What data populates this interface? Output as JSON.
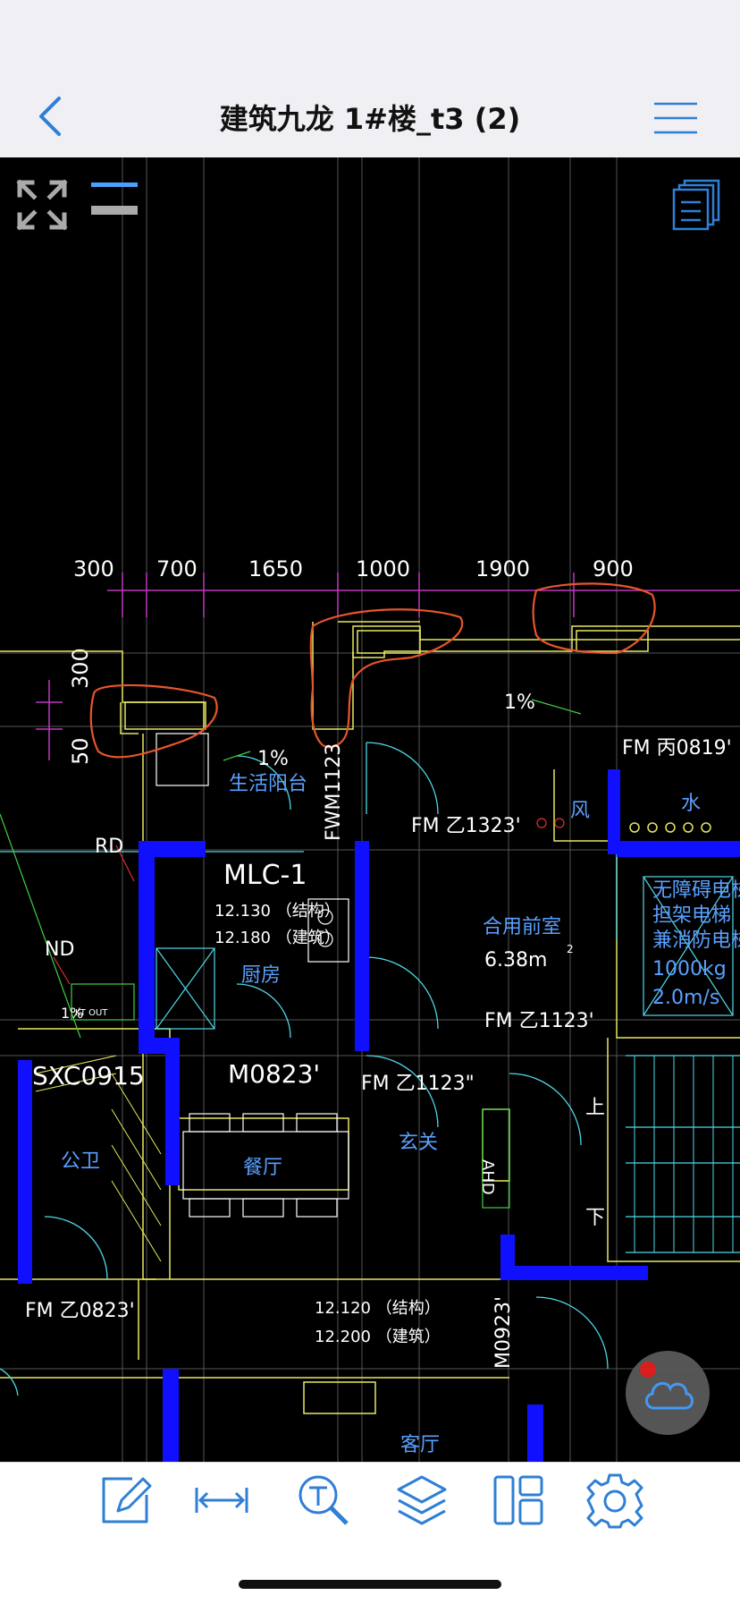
{
  "header": {
    "title": "建筑九龙 1#楼_t3 (2)",
    "back_icon": "chevron-left-icon",
    "menu_icon": "hamburger-menu-icon"
  },
  "canvas_tools": {
    "fullscreen_icon": "expand-arrows-icon",
    "layers_toggle_icon": "line-weight-icon",
    "sheets_icon": "sheets-list-icon"
  },
  "drawing": {
    "dimensions": [
      "300",
      "700",
      "1650",
      "1000",
      "1900",
      "900"
    ],
    "side_dimensions": [
      "300",
      "50"
    ],
    "labels": {
      "slope1": "1%",
      "slope2": "1%",
      "slope3": "1%",
      "balcony": "生活阳台",
      "fwm": "FWM1123",
      "fm_z1323": "FM 乙1323'",
      "fm_b0819": "FM 丙0819'",
      "wind": "风",
      "water": "水",
      "rd": "RD",
      "nd": "ND",
      "mlc": "MLC-1",
      "elev1_a": "12.130 （结构）",
      "elev1_b": "12.180 （建筑）",
      "kitchen": "厨房",
      "shared_lobby": "合用前室",
      "shared_lobby_area": "6.38m",
      "area_sup": "2",
      "elevator1": "无障碍电梯",
      "elevator2": "担架电梯",
      "elevator3": "兼消防电梯",
      "elevator4": "1000kg",
      "elevator5": "2.0m/s",
      "fm_z1123a": "FM 乙1123'",
      "kt_out": "KT OUT",
      "sxc": "SXC0915",
      "m0823": "M0823'",
      "fm_z1123b": "FM 乙1123\"",
      "up": "上",
      "down": "下",
      "public_wc": "公卫",
      "dining": "餐厅",
      "foyer": "玄关",
      "ahd": "AHD",
      "fm_z0823": "FM 乙0823'",
      "elev2_a": "12.120 （结构）",
      "elev2_b": "12.200 （建筑）",
      "m0923": "M0923'",
      "living": "客厅"
    }
  },
  "cloud": {
    "icon": "cloud-sync-icon",
    "badge_color": "#e62020"
  },
  "toolbar": {
    "items": [
      {
        "name": "annotate-button",
        "icon": "pencil-edit-icon"
      },
      {
        "name": "measure-button",
        "icon": "measure-arrows-icon"
      },
      {
        "name": "text-search-button",
        "icon": "text-search-icon"
      },
      {
        "name": "layers-button",
        "icon": "layers-icon"
      },
      {
        "name": "layout-button",
        "icon": "layout-panels-icon"
      },
      {
        "name": "settings-button",
        "icon": "gear-icon"
      }
    ]
  },
  "colors": {
    "accent": "#2f7fd6",
    "wall_blue": "#1010ff",
    "markup_red": "#e8552b",
    "dim_magenta": "#c038c0",
    "cad_yellow": "#e8e860",
    "cad_cyan": "#50d8e8",
    "cad_white": "#ffffff"
  }
}
